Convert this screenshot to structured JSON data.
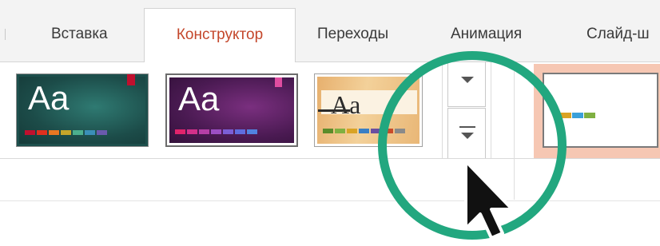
{
  "tabs": [
    {
      "label": "Вставка",
      "active": false
    },
    {
      "label": "Конструктор",
      "active": true
    },
    {
      "label": "Переходы",
      "active": false
    },
    {
      "label": "Анимация",
      "active": false
    },
    {
      "label": "Слайд-ш",
      "active": false
    }
  ],
  "themes": [
    {
      "name": "theme-teal",
      "sample_text": "Aa",
      "bg": "#1d4f4c",
      "corner": "#c0102e",
      "swatches": [
        "#c0102e",
        "#e0301e",
        "#e87722",
        "#c5a52a",
        "#4caf8e",
        "#3a8fb7",
        "#6a5aad"
      ]
    },
    {
      "name": "theme-purple",
      "sample_text": "Aa",
      "bg": "#4a1a52",
      "corner": "#e04da0",
      "swatches": [
        "#e0236b",
        "#d2308a",
        "#b53fa6",
        "#9c4fc4",
        "#7b5fd6",
        "#5f6de0",
        "#5183e0"
      ]
    },
    {
      "name": "theme-wood",
      "sample_text": "Aa",
      "bg": "#e8b77a",
      "corner": "#333333",
      "swatches": [
        "#5b8c2a",
        "#7fb041",
        "#d9a325",
        "#3a7fc4",
        "#6a4fa0",
        "#c94b2a",
        "#8a8a8a"
      ]
    }
  ],
  "gallery_controls": {
    "scroll_up_icon": "triangle-down-icon",
    "more_icon": "expand-gallery-icon"
  },
  "variant": {
    "swatches": [
      "#d9a325",
      "#3aa0d9",
      "#7fb041"
    ]
  },
  "colors": {
    "active_tab": "#c4472b",
    "highlight_ring": "#22a77f"
  }
}
